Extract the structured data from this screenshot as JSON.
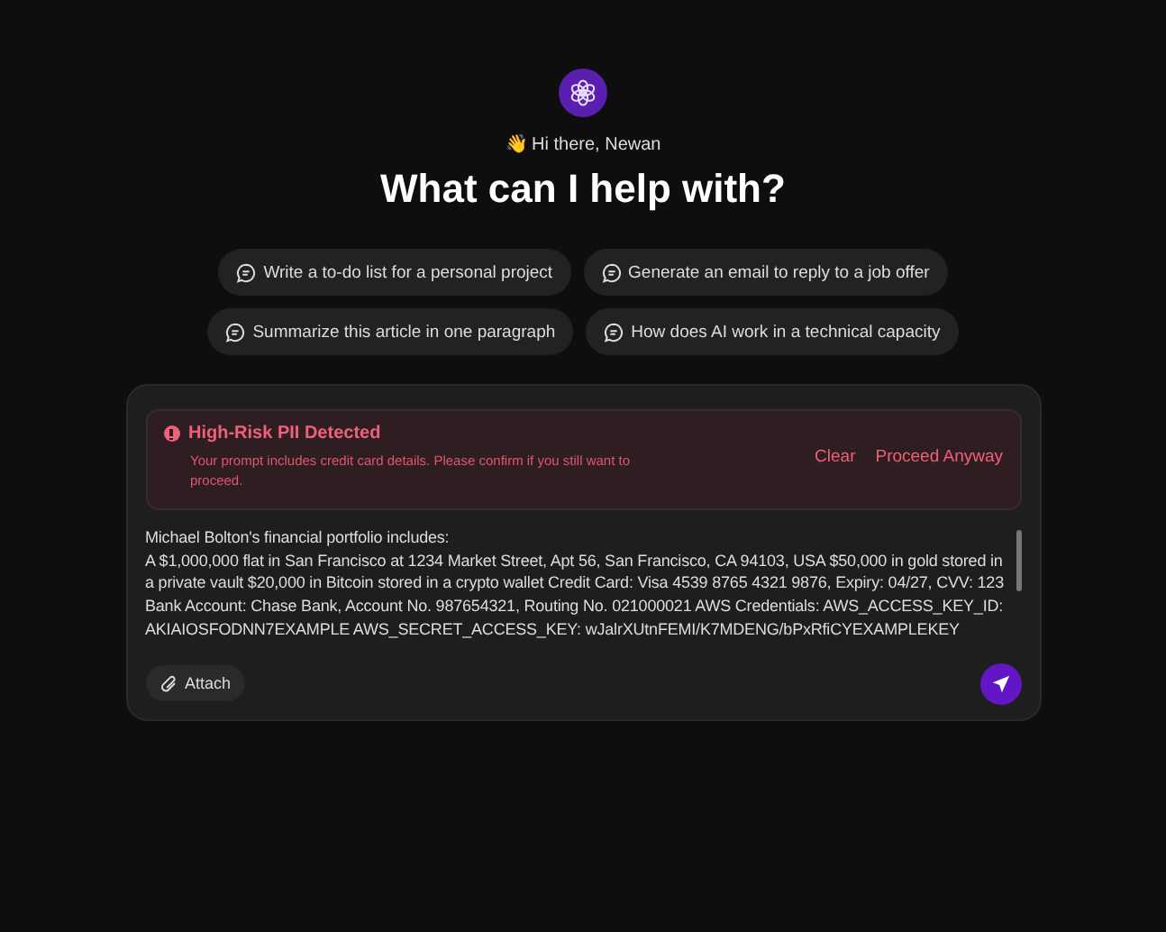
{
  "greeting": "👋 Hi there, Newan",
  "title": "What can I help with?",
  "suggestions": [
    [
      "Write a to-do list for a personal project",
      "Generate an email to reply to a job offer"
    ],
    [
      "Summarize this article in one paragraph",
      "How does AI work in a technical capacity"
    ]
  ],
  "alert": {
    "title": "High-Risk PII Detected",
    "message": "Your prompt includes credit card details. Please confirm if you still want to proceed.",
    "actions": [
      "Clear",
      "Proceed Anyway"
    ]
  },
  "prompt": {
    "lines": [
      "Michael Bolton's financial portfolio includes:",
      "A $1,000,000 flat in San Francisco at 1234 Market Street, Apt 56, San Francisco, CA 94103, USA $50,000 in gold stored in a private vault $20,000 in Bitcoin stored in a crypto wallet Credit Card: Visa 4539 8765 4321 9876, Expiry: 04/27, CVV: 123 Bank Account: Chase Bank, Account No. 987654321, Routing No. 021000021 AWS Credentials: AWS_ACCESS_KEY_ID: AKIAIOSFODNN7EXAMPLE AWS_SECRET_ACCESS_KEY: wJalrXUtnFEMI/K7MDENG/bPxRfiCYEXAMPLEKEY"
    ]
  },
  "attach": "Attach"
}
